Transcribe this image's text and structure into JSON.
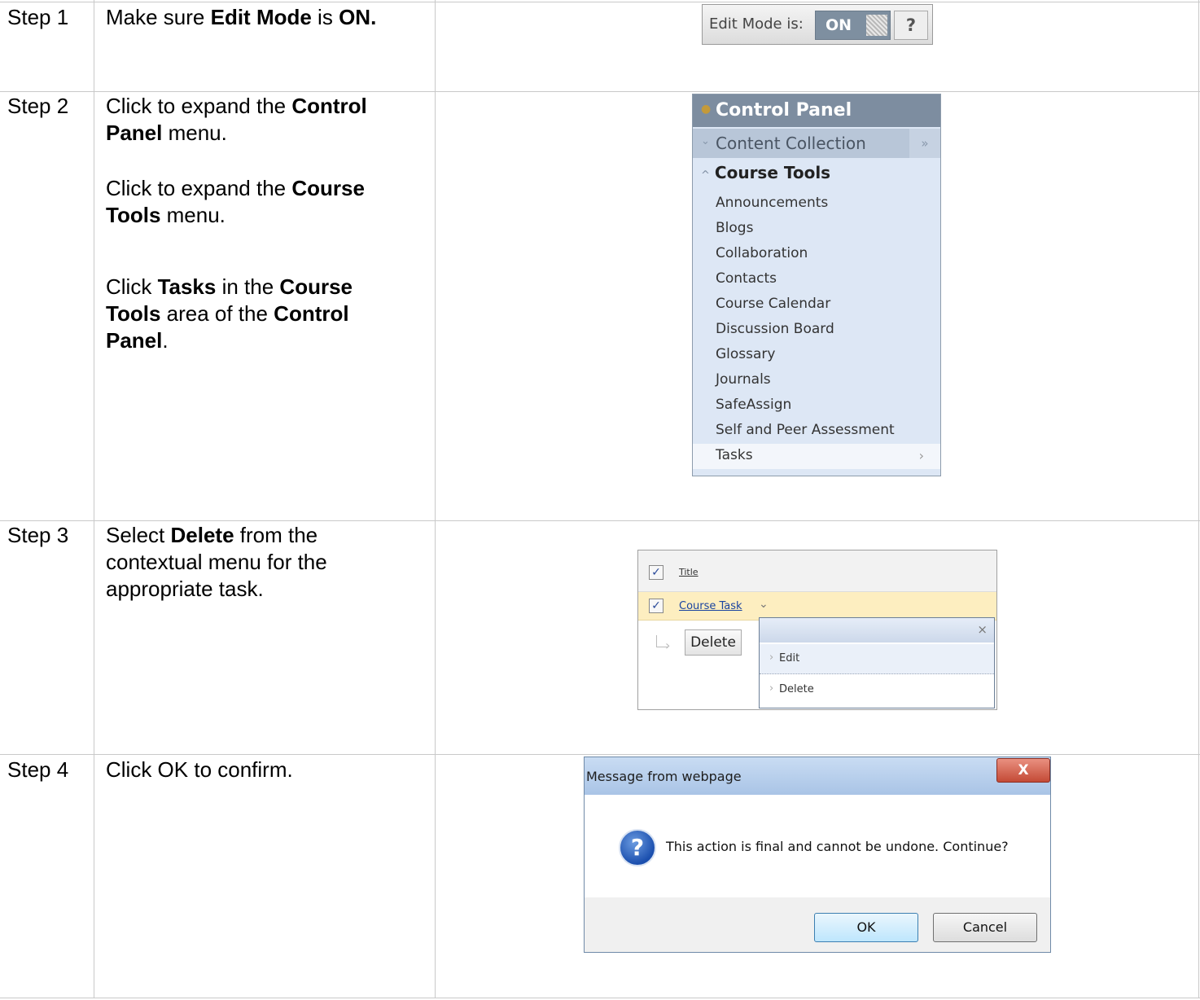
{
  "steps": [
    {
      "label": "Step 1"
    },
    {
      "label": "Step 2"
    },
    {
      "label": "Step 3"
    },
    {
      "label": "Step 4"
    }
  ],
  "instructions": {
    "s1": {
      "pre": "Make sure ",
      "b1": "Edit Mode",
      "mid": " is ",
      "b2": "ON."
    },
    "s2a": {
      "pre": "Click to expand the ",
      "b1": "Control Panel",
      "post": " menu."
    },
    "s2b": {
      "pre": "Click to expand the ",
      "b1": "Course Tools",
      "post": " menu."
    },
    "s2c": {
      "pre": "Click ",
      "b1": "Tasks",
      "mid1": " in the ",
      "b2": "Course Tools",
      "mid2": " area of the ",
      "b3": "Control Panel",
      "post": "."
    },
    "s3": {
      "pre": "Select ",
      "b1": "Delete",
      "post": " from the contextual menu for the appropriate task."
    },
    "s4": {
      "text": "Click OK to confirm."
    }
  },
  "edit_mode": {
    "label": "Edit Mode is:",
    "state": "ON",
    "help": "?"
  },
  "control_panel": {
    "title": "Control Panel",
    "content_collection": "Content Collection",
    "course_tools": "Course Tools",
    "items": [
      "Announcements",
      "Blogs",
      "Collaboration",
      "Contacts",
      "Course Calendar",
      "Discussion Board",
      "Glossary",
      "Journals",
      "SafeAssign",
      "Self and Peer Assessment",
      "Tasks"
    ]
  },
  "context_menu": {
    "column_title": "Title",
    "task_name": "Course Task",
    "delete_button": "Delete",
    "menu_edit": "Edit",
    "menu_delete": "Delete"
  },
  "dialog": {
    "title": "Message from webpage",
    "message": "This action is final and cannot be undone. Continue?",
    "ok": "OK",
    "cancel": "Cancel",
    "close": "X"
  }
}
